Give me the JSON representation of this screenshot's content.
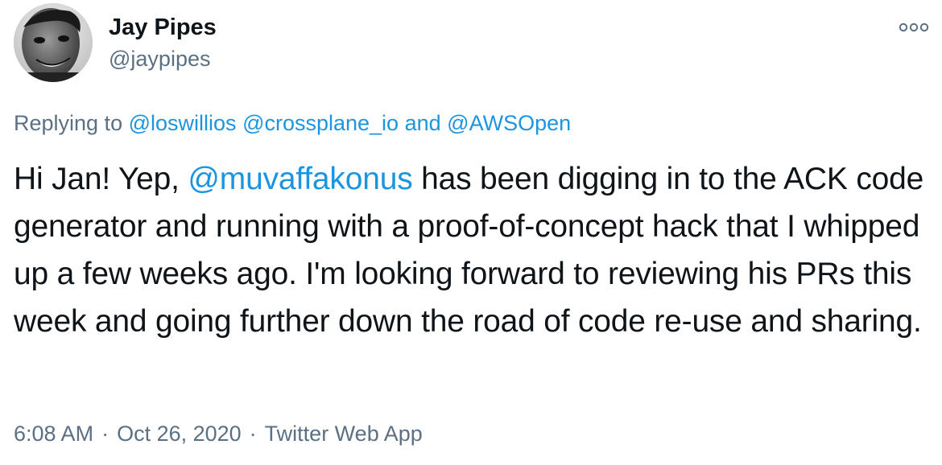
{
  "author": {
    "display_name": "Jay Pipes",
    "handle": "@jaypipes"
  },
  "more_icon": "more-horizontal-icon",
  "reply": {
    "prefix": "Replying to",
    "mentions": [
      "@loswillios",
      "@crossplane_io",
      "@AWSOpen"
    ],
    "joiner": "and"
  },
  "tweet": {
    "text_before": "Hi Jan! Yep, ",
    "mention": "@muvaffakonus",
    "text_after": " has been digging in to the ACK code generator and running with a proof-of-concept hack that I whipped up a few weeks ago. I'm looking forward to reviewing his PRs this week and going further down the road of code re-use and sharing."
  },
  "meta": {
    "time": "6:08 AM",
    "separator": "·",
    "date": "Oct 26, 2020",
    "source": "Twitter Web App"
  },
  "colors": {
    "link": "#1b95e0",
    "secondary_text": "#5b7083",
    "primary_text": "#0f1419"
  }
}
